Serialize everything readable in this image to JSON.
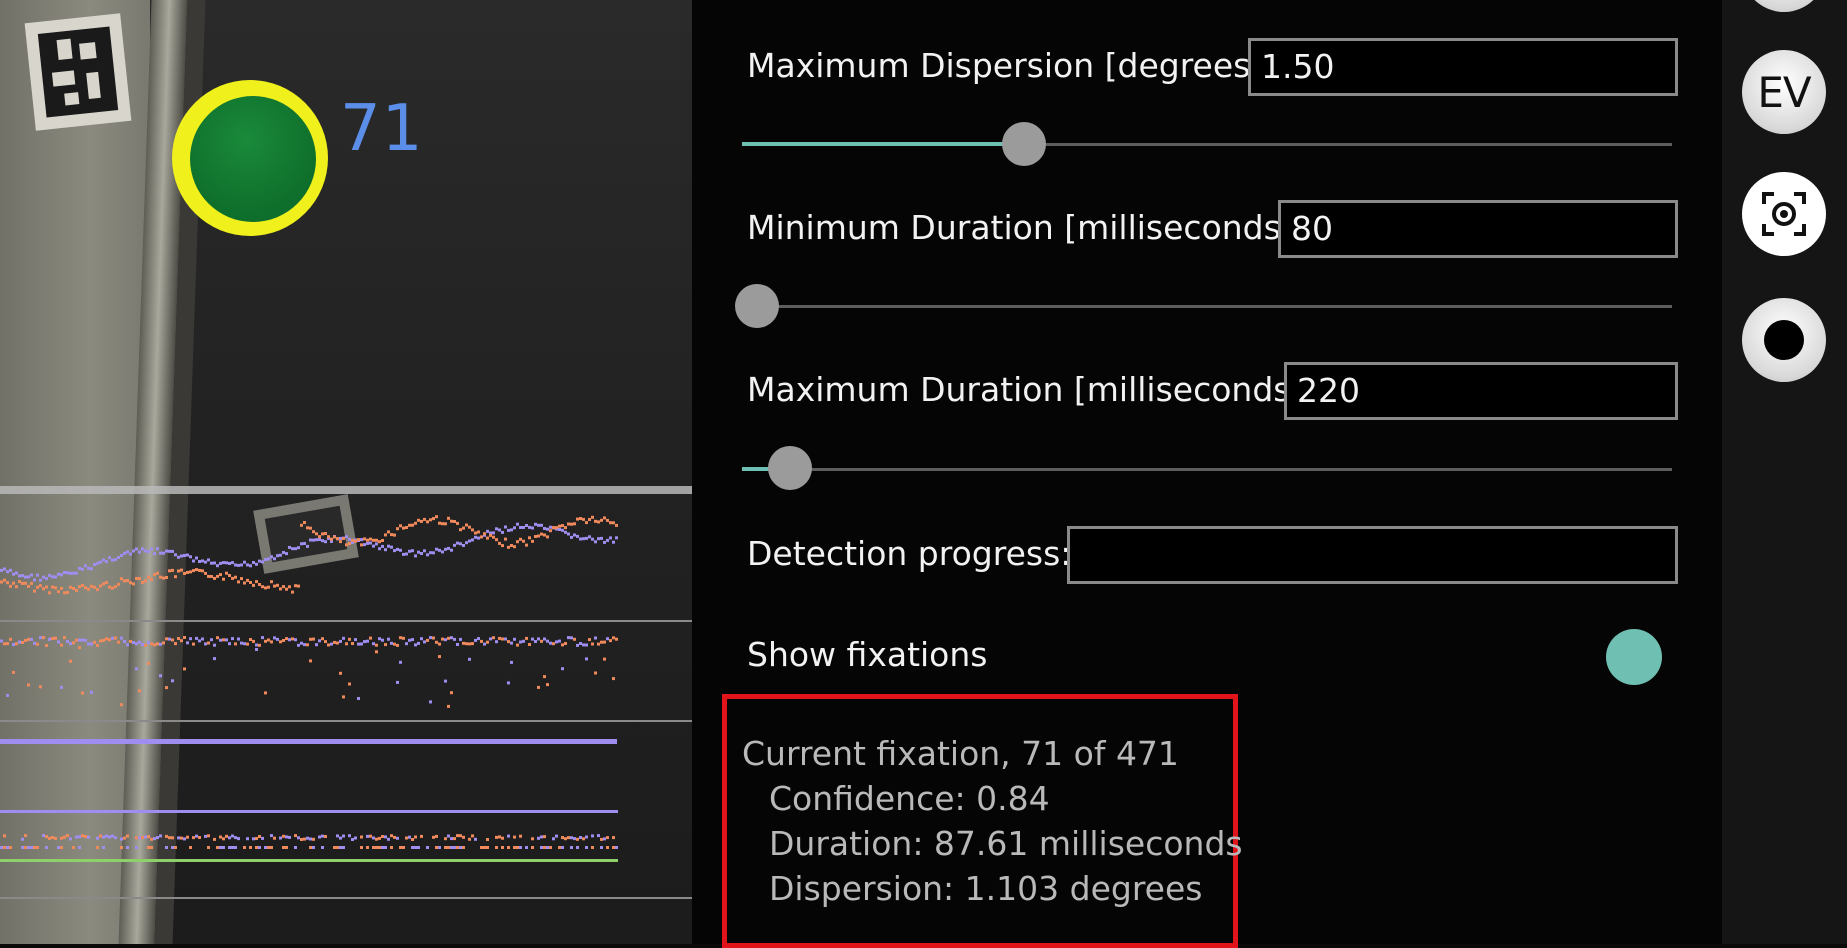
{
  "scene": {
    "fixation_number": "71"
  },
  "settings": {
    "max_dispersion": {
      "label": "Maximum Dispersion [degrees]",
      "value": "1.50",
      "slider_fraction": 0.3
    },
    "min_duration": {
      "label": "Minimum Duration [milliseconds]",
      "value": "80",
      "slider_fraction": 0.0
    },
    "max_duration": {
      "label": "Maximum Duration [milliseconds]",
      "value": "220",
      "slider_fraction": 0.035
    },
    "detection_progress": {
      "label": "Detection progress:",
      "value": ""
    },
    "show_fixations": {
      "label": "Show fixations",
      "enabled": true
    }
  },
  "fixation_info": {
    "title": "Current fixation, 71 of 471",
    "confidence": "Confidence: 0.84",
    "duration": "Duration: 87.61 milliseconds",
    "dispersion": "Dispersion: 1.103 degrees"
  },
  "rail": {
    "ev_label": "EV",
    "icons": [
      "ev-button-icon",
      "screenshot-capture-icon",
      "record-icon"
    ]
  },
  "colors": {
    "accent": "#6fbfb2",
    "series_a": "#a08df0",
    "series_b": "#f08a5d",
    "series_c": "#8ed06a",
    "highlight_box": "#e0141a",
    "fixation_ring": "#f0f01c",
    "fixation_fill": "#0e6e2b",
    "fixation_number": "#5b8ee8"
  }
}
